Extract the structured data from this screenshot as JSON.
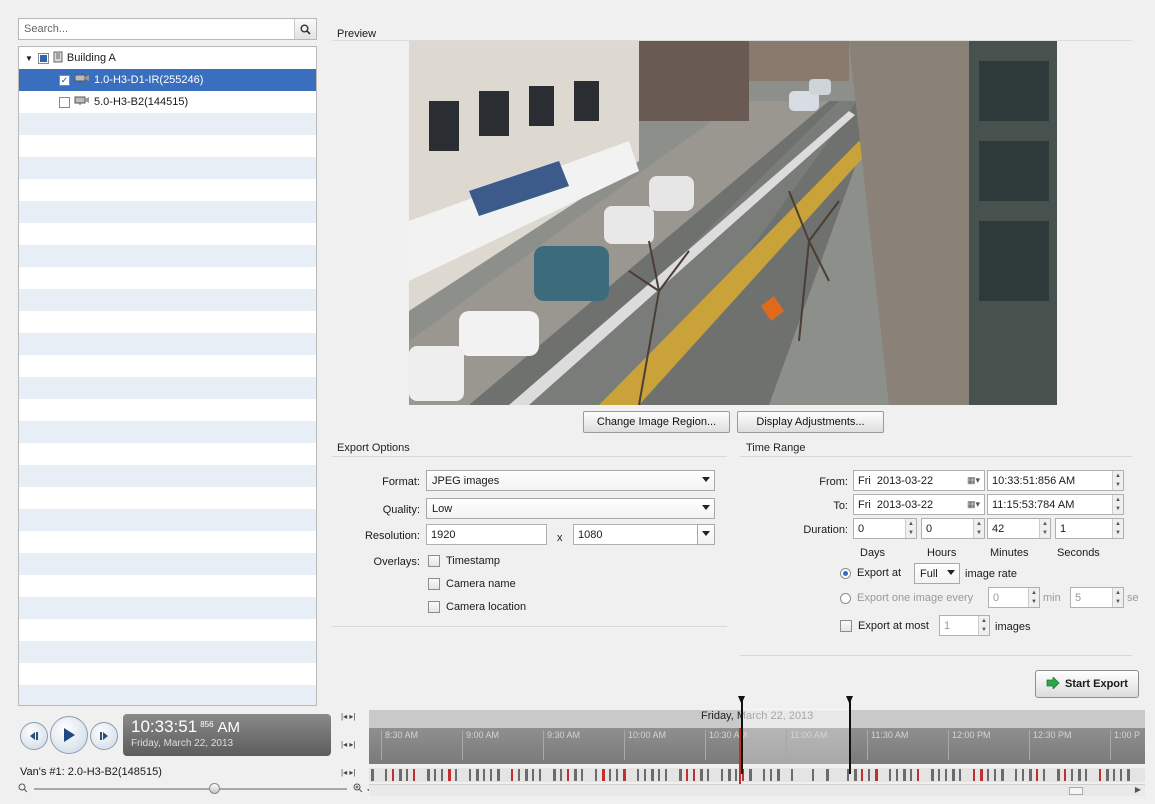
{
  "search": {
    "placeholder": "Search..."
  },
  "tree": {
    "root": "Building A",
    "cameras": [
      {
        "label": "1.0-H3-D1-IR(255246)",
        "checked": true,
        "selected": true
      },
      {
        "label": "5.0-H3-B2(144515)",
        "checked": false,
        "selected": false
      }
    ]
  },
  "player": {
    "time": "10:33:51",
    "ms": "856",
    "ampm": "AM",
    "date": "Friday, March 22, 2013",
    "camera_label": "Van's #1: 2.0-H3-B2(148515)"
  },
  "preview": {
    "label": "Preview",
    "change_region_button": "Change Image Region...",
    "display_adjustments_button": "Display Adjustments..."
  },
  "export_options": {
    "title": "Export Options",
    "format_label": "Format:",
    "format_value": "JPEG images",
    "quality_label": "Quality:",
    "quality_value": "Low",
    "resolution_label": "Resolution:",
    "width": "1920",
    "x_sep": "x",
    "height": "1080",
    "overlays_label": "Overlays:",
    "overlays": [
      "Timestamp",
      "Camera name",
      "Camera location"
    ]
  },
  "time_range": {
    "title": "Time Range",
    "from_label": "From:",
    "from_day": "Fri",
    "from_date": "2013-03-22",
    "from_time": "10:33:51:856  AM",
    "to_label": "To:",
    "to_day": "Fri",
    "to_date": "2013-03-22",
    "to_time": "11:15:53:784  AM",
    "duration_label": "Duration:",
    "days": "0",
    "hours": "0",
    "minutes": "42",
    "seconds": "1",
    "days_label": "Days",
    "hours_label": "Hours",
    "minutes_label": "Minutes",
    "seconds_label": "Seconds",
    "export_at_label": "Export at",
    "rate_value": "Full",
    "image_rate_label": "image rate",
    "export_every_label": "Export one image every",
    "every_min": "0",
    "min_label": "min",
    "every_sec": "5",
    "sec_label": "se",
    "export_at_most_label": "Export at most",
    "at_most_value": "1",
    "images_label": "images"
  },
  "start_export_button": "Start Export",
  "timeline": {
    "date_label": "Friday, March 22, 2013",
    "ticks": [
      "8:30 AM",
      "9:00 AM",
      "9:30 AM",
      "10:00 AM",
      "10:30 AM",
      "11:00 AM",
      "11:30 AM",
      "12:00 PM",
      "12:30 PM",
      "1:00 P"
    ]
  },
  "colors": {
    "selection": "#3a6fbf",
    "export_green": "#2fa64a",
    "timeline_red": "#c0302f"
  }
}
